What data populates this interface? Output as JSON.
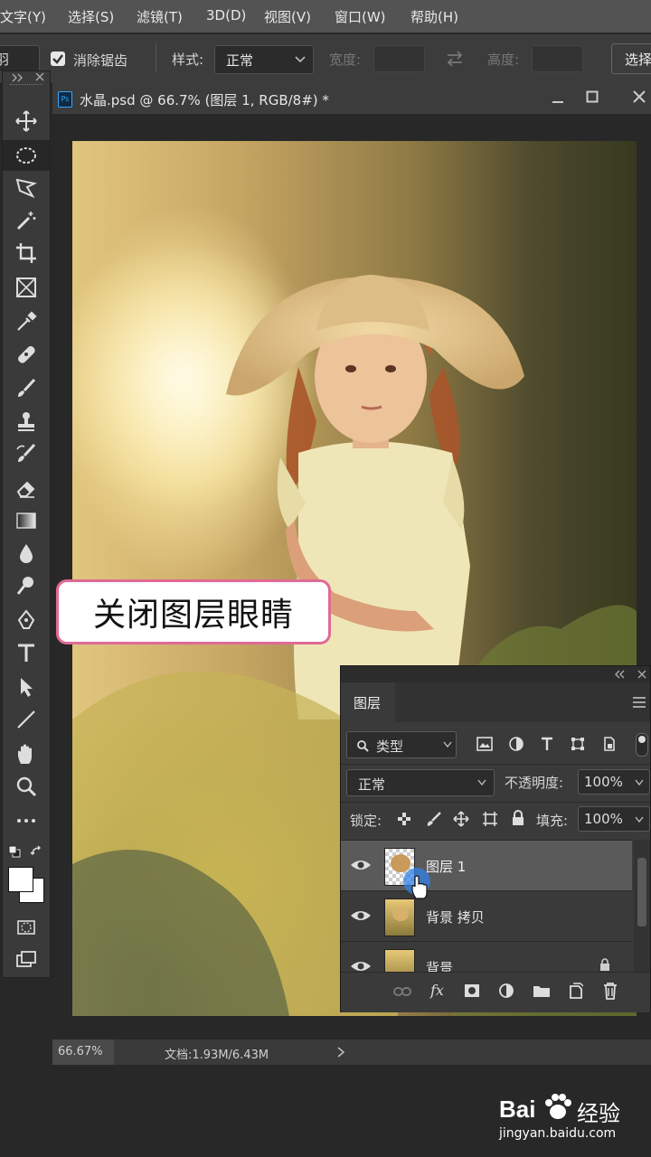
{
  "menubar": {
    "items": [
      "文字(Y)",
      "选择(S)",
      "滤镜(T)",
      "3D(D)",
      "视图(V)",
      "窗口(W)",
      "帮助(H)"
    ]
  },
  "options": {
    "feather_label": "羽",
    "antialias_label": "消除锯齿",
    "antialias_checked": true,
    "style_label": "样式:",
    "style_value": "正常",
    "width_label": "宽度:",
    "height_label": "高度:",
    "select_button": "选择"
  },
  "document": {
    "tab_title": "水晶.psd @ 66.7% (图层 1, RGB/8#) *",
    "ps_badge": "Ps"
  },
  "caption": {
    "text": "关闭图层眼睛"
  },
  "status": {
    "zoom": "66.67%",
    "doc_info": "文档:1.93M/6.43M"
  },
  "layers_panel": {
    "tab_label": "图层",
    "filter_label": "类型",
    "blend_mode": "正常",
    "opacity_label": "不透明度:",
    "opacity_value": "100%",
    "lock_label": "锁定:",
    "fill_label": "填充:",
    "fill_value": "100%",
    "layers": [
      {
        "name": "图层 1",
        "visible": true,
        "selected": true
      },
      {
        "name": "背景 拷贝",
        "visible": true,
        "selected": false
      },
      {
        "name": "背景",
        "visible": true,
        "selected": false
      }
    ]
  },
  "watermark": {
    "brand": "Bai",
    "brand2": "经验",
    "url": "jingyan.baidu.com"
  },
  "colors": {
    "accent_pink": "#e06a95",
    "panel_bg": "#3a3a3a",
    "selected_layer": "#5a5a5a"
  }
}
